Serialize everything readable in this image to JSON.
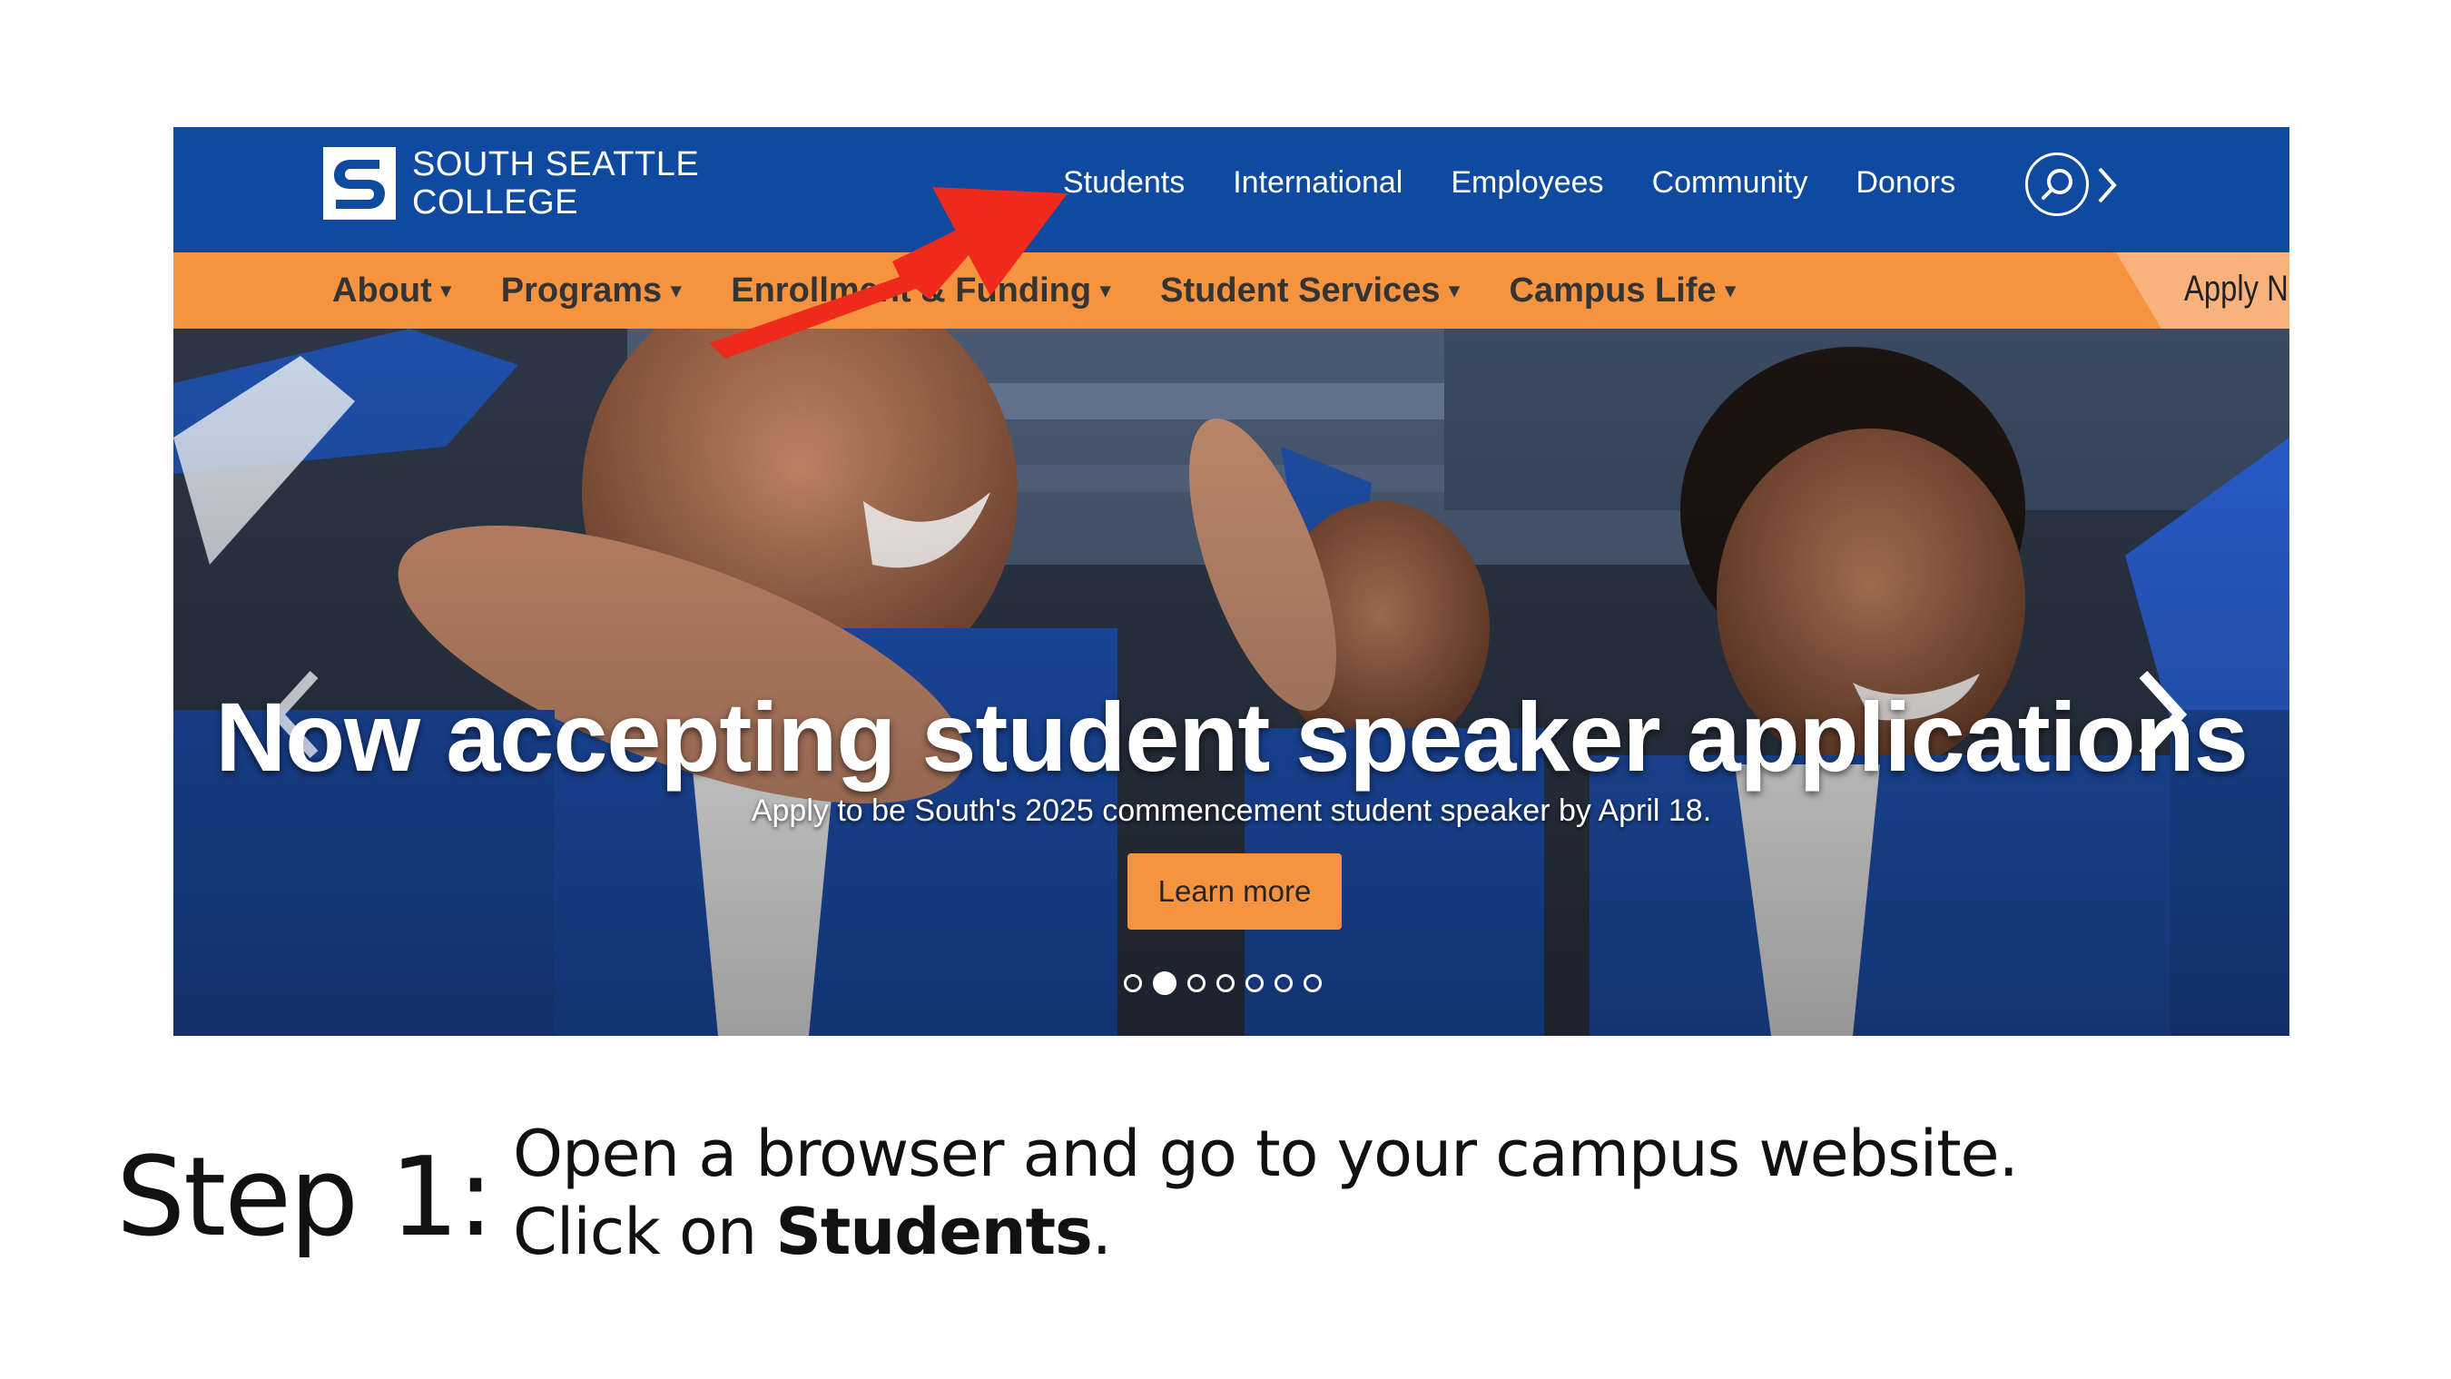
{
  "header": {
    "logo_line1": "SOUTH SEATTLE",
    "logo_line2": "COLLEGE",
    "top_nav": [
      "Students",
      "International",
      "Employees",
      "Community",
      "Donors"
    ],
    "search_icon": "search-icon",
    "more_icon": "chevron-right-icon"
  },
  "main_nav": {
    "items": [
      "About",
      "Programs",
      "Enrollment & Funding",
      "Student Services",
      "Campus Life"
    ],
    "apply_label": "Apply Now"
  },
  "hero": {
    "title": "Now accepting student speaker applications",
    "subtitle": "Apply to be South's 2025 commencement student speaker by April 18.",
    "button": "Learn more",
    "slide_count": 7,
    "active_slide": 2
  },
  "caption": {
    "step": "Step 1:",
    "line1": "Open a browser and go to your campus website.",
    "line2_prefix": "Click on ",
    "line2_bold": "Students",
    "line2_suffix": "."
  },
  "colors": {
    "header_blue": "#0f49a0",
    "nav_orange": "#f6933f",
    "annotation_red": "#ee2a1b"
  }
}
